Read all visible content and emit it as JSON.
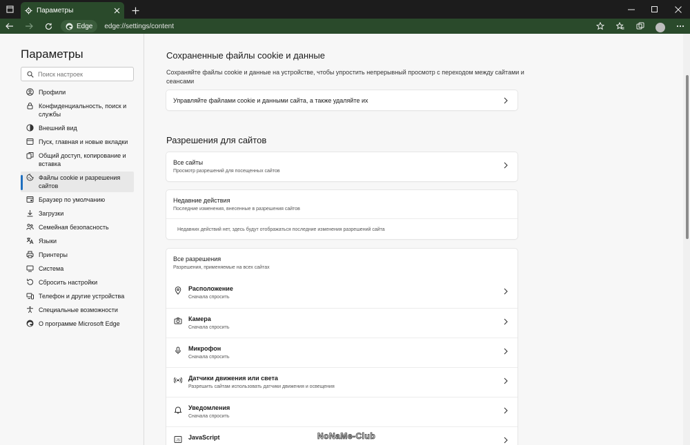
{
  "window": {
    "tab_title": "Параметры",
    "new_tab": "+"
  },
  "address": {
    "site_label": "Edge",
    "url": "edge://settings/content"
  },
  "sidebar": {
    "title": "Параметры",
    "search_placeholder": "Поиск настроек",
    "items": [
      {
        "label": "Профили",
        "icon": "profile-icon"
      },
      {
        "label": "Конфиденциальность, поиск и службы",
        "icon": "lock-icon"
      },
      {
        "label": "Внешний вид",
        "icon": "appearance-icon"
      },
      {
        "label": "Пуск, главная и новые вкладки",
        "icon": "home-tabs-icon"
      },
      {
        "label": "Общий доступ, копирование и вставка",
        "icon": "share-icon"
      },
      {
        "label": "Файлы cookie и разрешения сайтов",
        "icon": "cookie-icon",
        "active": true
      },
      {
        "label": "Браузер по умолчанию",
        "icon": "browser-icon"
      },
      {
        "label": "Загрузки",
        "icon": "download-icon"
      },
      {
        "label": "Семейная безопасность",
        "icon": "family-icon"
      },
      {
        "label": "Языки",
        "icon": "language-icon"
      },
      {
        "label": "Принтеры",
        "icon": "printer-icon"
      },
      {
        "label": "Система",
        "icon": "system-icon"
      },
      {
        "label": "Сбросить настройки",
        "icon": "reset-icon"
      },
      {
        "label": "Телефон и другие устройства",
        "icon": "phone-icon"
      },
      {
        "label": "Специальные возможности",
        "icon": "accessibility-icon"
      },
      {
        "label": "О программе Microsoft Edge",
        "icon": "edge-logo-icon"
      }
    ]
  },
  "main": {
    "cookies_section": {
      "title": "Сохраненные файлы cookie и данные",
      "description": "Сохраняйте файлы cookie и данные на устройстве, чтобы упростить непрерывный просмотр с переходом между сайтами и сеансами",
      "manage_label": "Управляйте файлами cookie и данными сайта, а также удаляйте их"
    },
    "permissions_section": {
      "title": "Разрешения для сайтов",
      "all_sites": {
        "title": "Все сайты",
        "subtitle": "Просмотр разрешений для посещенных сайтов"
      },
      "recent": {
        "title": "Недавние действия",
        "subtitle": "Последние изменения, внесенные в разрешения сайтов",
        "empty": "Недавних действий нет, здесь будут отображаться последние изменения разрешений сайта"
      },
      "all_permissions": {
        "title": "Все разрешения",
        "subtitle": "Разрешения, применяемые на всех сайтах"
      },
      "permissions": [
        {
          "title": "Расположение",
          "subtitle": "Сначала спросить",
          "icon": "location-icon"
        },
        {
          "title": "Камера",
          "subtitle": "Сначала спросить",
          "icon": "camera-icon"
        },
        {
          "title": "Микрофон",
          "subtitle": "Сначала спросить",
          "icon": "microphone-icon"
        },
        {
          "title": "Датчики движения или света",
          "subtitle": "Разрешить сайтам использовать датчики движения и освещения",
          "icon": "sensor-icon"
        },
        {
          "title": "Уведомления",
          "subtitle": "Сначала спросить",
          "icon": "bell-icon"
        },
        {
          "title": "JavaScript",
          "subtitle": "",
          "icon": "code-icon"
        }
      ]
    }
  },
  "watermark": "NoNaMe-Club"
}
